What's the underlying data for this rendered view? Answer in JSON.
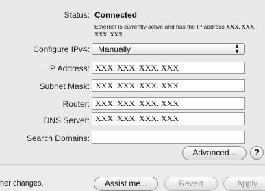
{
  "status": {
    "label": "Status:",
    "value": "Connected",
    "description": "Ethernet is currently active and has the IP address",
    "address": "XXX. XXX. XXX. XXX"
  },
  "configure": {
    "label": "Configure IPv4:",
    "value": "Manually",
    "arrows_icon": "updown-arrows-icon"
  },
  "fields": {
    "ip": {
      "label": "IP Address:",
      "value": "XXX. XXX. XXX. XXX"
    },
    "subnet": {
      "label": "Subnet Mask:",
      "value": "XXX. XXX. XXX. XXX"
    },
    "router": {
      "label": "Router:",
      "value": "XXX. XXX. XXX. XXX"
    },
    "dns": {
      "label": "DNS Server:",
      "value": "XXX. XXX. XXX. XXX"
    },
    "search": {
      "label": "Search Domains:",
      "value": ""
    }
  },
  "buttons": {
    "advanced": "Advanced...",
    "help": "?",
    "assist": "Assist me...",
    "revert": "Revert",
    "apply": "Apply"
  },
  "footer": {
    "text": "her changes."
  }
}
